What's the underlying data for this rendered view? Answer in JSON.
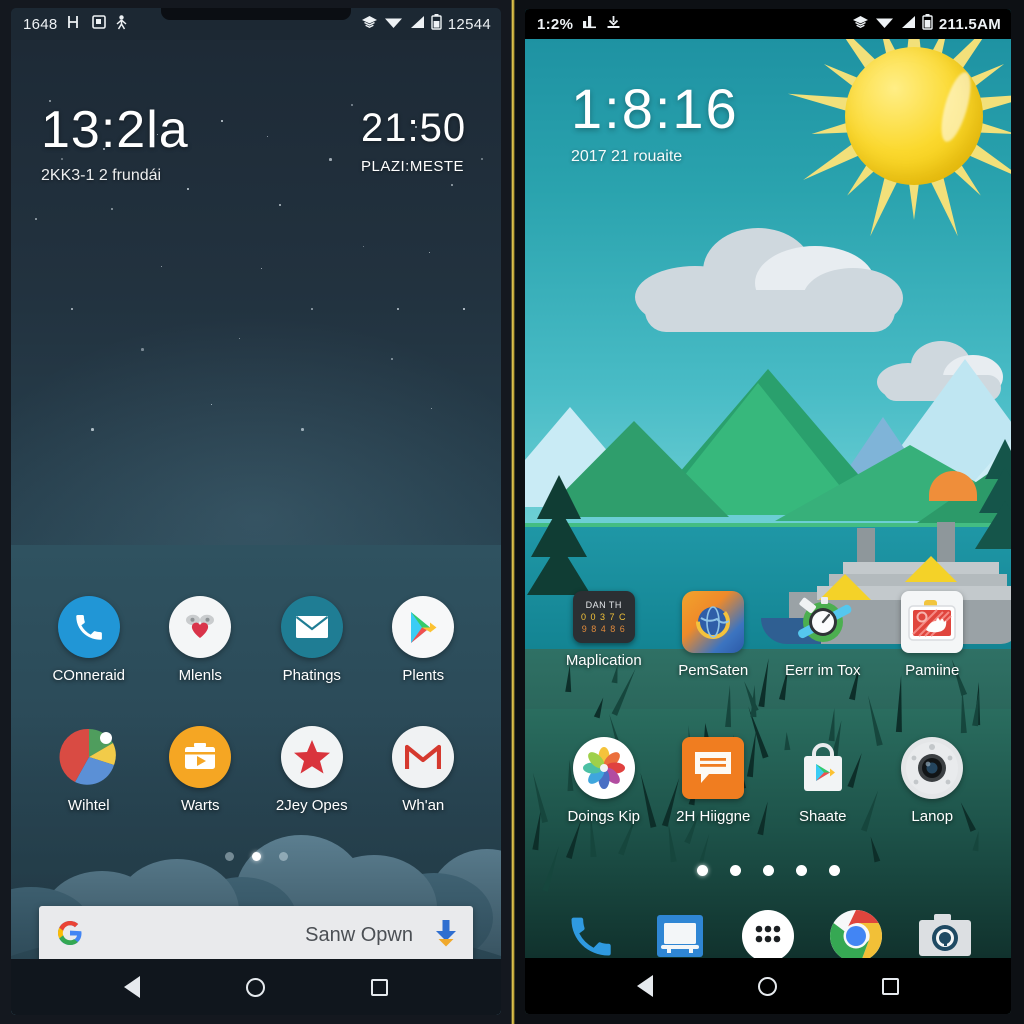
{
  "scene": {
    "description": "Side-by-side comparison of two Android home screens"
  },
  "left_phone": {
    "status_bar": {
      "time": "1648",
      "icons": [
        "hd-icon",
        "screenshot-icon",
        "person-icon"
      ],
      "right_icons": [
        "cast-icon",
        "wifi-icon",
        "signal-icon",
        "battery-icon"
      ],
      "right_text": "12544"
    },
    "widget_primary": {
      "time": "13:2la",
      "subtitle": "2KK3-1 2 frundái"
    },
    "widget_secondary": {
      "time": "21:50",
      "subtitle": "PLAZI:MESTE"
    },
    "apps_row1": [
      {
        "label": "COnneraid",
        "icon": "phone-icon",
        "color": "#2196d6"
      },
      {
        "label": "Mlenls",
        "icon": "heart-icon",
        "color": "#f4f6f7"
      },
      {
        "label": "Phatings",
        "icon": "mail-icon",
        "color": "#1f7d94"
      },
      {
        "label": "Plents",
        "icon": "play-store-icon",
        "color": "#f7f8f9"
      }
    ],
    "apps_row2": [
      {
        "label": "Wihtel",
        "icon": "pie-chart-icon",
        "color": "#f0f2f3"
      },
      {
        "label": "Warts",
        "icon": "toolbox-play-icon",
        "color": "#f5a623"
      },
      {
        "label": "2Jey Opes",
        "icon": "star-icon",
        "color": "#f2f4f5"
      },
      {
        "label": "Wh'an",
        "icon": "gmail-icon",
        "color": "#f0f2f3"
      }
    ],
    "page_dots": {
      "count": 3,
      "active": 1
    },
    "search_bar": {
      "logo": "google-g-icon",
      "text": "Sanw Opwn",
      "trailing_icon": "download-arrow-icon"
    },
    "nav_bar": [
      "back-icon",
      "home-icon",
      "recents-icon"
    ]
  },
  "right_phone": {
    "status_bar": {
      "time": "1:2%",
      "icons": [
        "chart-icon",
        "download-icon"
      ],
      "right_icons": [
        "cast-icon",
        "wifi-icon",
        "signal-icon",
        "battery-icon"
      ],
      "right_text": "211.5AM"
    },
    "widget": {
      "time": "1:8:16",
      "subtitle": "2017 21 rouaite"
    },
    "apps_row1": [
      {
        "label": "Maplication",
        "icon": "clock-widget-icon",
        "color": "#2b2f33",
        "widget_title": "DAN TH",
        "widget_line1": "0 0 3 7 C",
        "widget_line2": "9 8 4 8 6"
      },
      {
        "label": "PemSaten",
        "icon": "browser-globe-icon",
        "color": "#3d78c4"
      },
      {
        "label": "Eerr im Tox",
        "icon": "compass-tools-icon",
        "color": "#4caf50"
      },
      {
        "label": "Pamiine",
        "icon": "tv-hand-icon",
        "color": "#e8403a"
      }
    ],
    "apps_row2": [
      {
        "label": "Doings Kip",
        "icon": "photos-flower-icon",
        "color": "#ffffff"
      },
      {
        "label": "2H Hiiggne",
        "icon": "messages-icon",
        "color": "#f07d20"
      },
      {
        "label": "Shaate",
        "icon": "play-store-bag-icon",
        "color": "#f2f3f4"
      },
      {
        "label": "Lanop",
        "icon": "camera-lens-icon",
        "color": "#e4e6e8"
      }
    ],
    "page_dots": {
      "count": 5,
      "active": 0
    },
    "dock": [
      {
        "icon": "phone-dock-icon",
        "color": "#2f9ae0"
      },
      {
        "icon": "laptop-dock-icon",
        "color": "#2f86d4"
      },
      {
        "icon": "app-drawer-icon",
        "color": "#ffffff"
      },
      {
        "icon": "chrome-dock-icon",
        "color": "#4285f4"
      },
      {
        "icon": "camera-dock-icon",
        "color": "#dcdfe2"
      }
    ],
    "nav_bar": [
      "back-icon",
      "home-icon",
      "recents-icon"
    ]
  },
  "colors": {
    "frame": "#c9a227",
    "divider": "#e8cf5a",
    "left_bg": "#22323f",
    "right_bg": "#2aa3ae"
  }
}
